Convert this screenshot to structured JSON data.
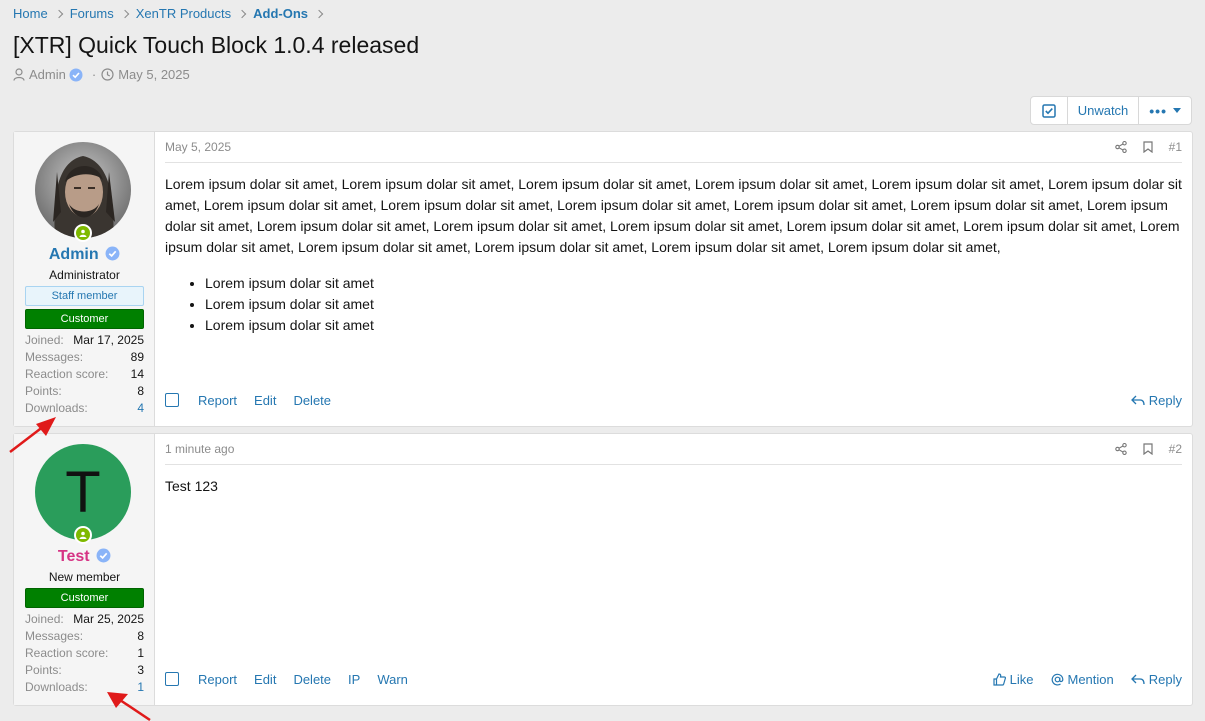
{
  "breadcrumb": [
    "Home",
    "Forums",
    "XenTR Products",
    "Add-Ons"
  ],
  "thread": {
    "title": "[XTR] Quick Touch Block 1.0.4 released",
    "author": "Admin",
    "date": "May 5, 2025"
  },
  "actions": {
    "unwatch": "Unwatch"
  },
  "posts": [
    {
      "username": "Admin",
      "user_title": "Administrator",
      "staff_badge": "Staff member",
      "group_badge": "Customer",
      "stats": [
        {
          "k": "Joined:",
          "v": "Mar 17, 2025"
        },
        {
          "k": "Messages:",
          "v": "89"
        },
        {
          "k": "Reaction score:",
          "v": "14"
        },
        {
          "k": "Points:",
          "v": "8"
        },
        {
          "k": "Downloads:",
          "v": "4"
        }
      ],
      "date": "May 5, 2025",
      "number": "#1",
      "text": "Lorem ipsum dolar sit amet, Lorem ipsum dolar sit amet, Lorem ipsum dolar sit amet, Lorem ipsum dolar sit amet, Lorem ipsum dolar sit amet, Lorem ipsum dolar sit amet, Lorem ipsum dolar sit amet, Lorem ipsum dolar sit amet, Lorem ipsum dolar sit amet, Lorem ipsum dolar sit amet, Lorem ipsum dolar sit amet, Lorem ipsum dolar sit amet, Lorem ipsum dolar sit amet, Lorem ipsum dolar sit amet, Lorem ipsum dolar sit amet, Lorem ipsum dolar sit amet, Lorem ipsum dolar sit amet, Lorem ipsum dolar sit amet, Lorem ipsum dolar sit amet, Lorem ipsum dolar sit amet, Lorem ipsum dolar sit amet, Lorem ipsum dolar sit amet,",
      "list": [
        "Lorem ipsum dolar sit amet",
        "Lorem ipsum dolar sit amet",
        "Lorem ipsum dolar sit amet"
      ],
      "footer_left": [
        "Report",
        "Edit",
        "Delete"
      ],
      "footer_right": [
        "Reply"
      ]
    },
    {
      "username": "Test",
      "user_title": "New member",
      "avatar_letter": "T",
      "group_badge": "Customer",
      "stats": [
        {
          "k": "Joined:",
          "v": "Mar 25, 2025"
        },
        {
          "k": "Messages:",
          "v": "8"
        },
        {
          "k": "Reaction score:",
          "v": "1"
        },
        {
          "k": "Points:",
          "v": "3"
        },
        {
          "k": "Downloads:",
          "v": "1"
        }
      ],
      "date": "1 minute ago",
      "number": "#2",
      "text": "Test 123",
      "footer_left": [
        "Report",
        "Edit",
        "Delete",
        "IP",
        "Warn"
      ],
      "footer_right": [
        "Like",
        "Mention",
        "Reply"
      ]
    }
  ],
  "colors": {
    "link": "#2577b1",
    "customer": "#008000",
    "test_user": "#d63384",
    "avatar_green": "#2a9d5b",
    "online": "#7fb900"
  }
}
